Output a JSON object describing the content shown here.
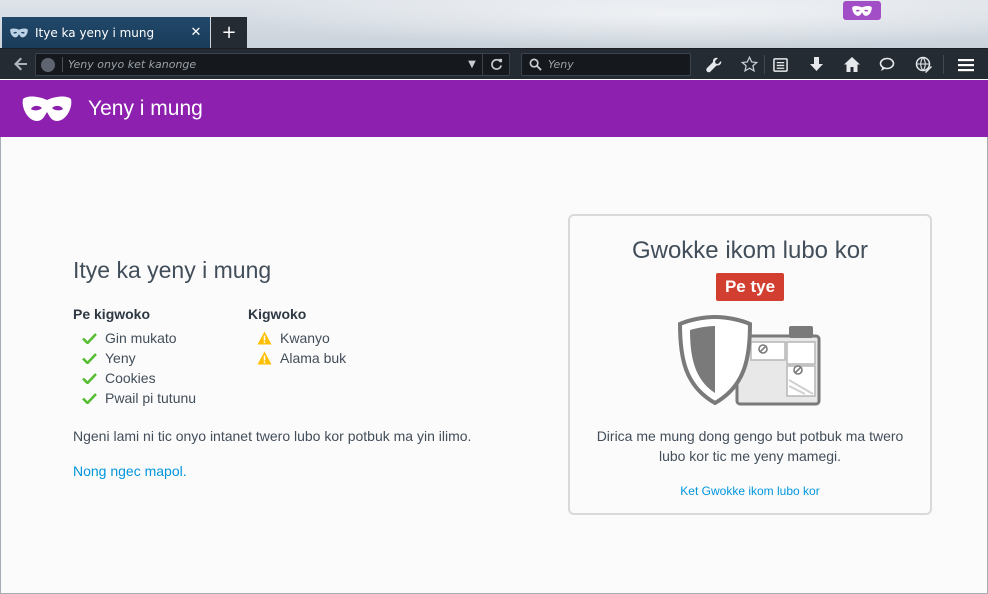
{
  "window": {
    "tab_title": "Itye ka yeny i mung",
    "tab_close": "✕",
    "new_tab": "+"
  },
  "navbar": {
    "url_placeholder": "Yeny onyo ket kanonge",
    "search_placeholder": "Yeny"
  },
  "header": {
    "title": "Yeny i mung"
  },
  "main": {
    "title": "Itye ka yeny i mung",
    "not_saved_heading": "Pe kigwoko",
    "not_saved_items": [
      "Gin mukato",
      "Yeny",
      "Cookies",
      "Pwail pi tutunu"
    ],
    "saved_heading": "Kigwoko",
    "saved_items": [
      "Kwanyo",
      "Alama buk"
    ],
    "description": "Ngeni lami ni tic onyo intanet twero lubo kor potbuk ma yin ilimo.",
    "learn_more": "Nong ngec mapol."
  },
  "tracking_card": {
    "title": "Gwokke ikom lubo kor",
    "status_badge": "Pe tye",
    "description": "Dirica me mung dong gengo but potbuk ma twero lubo kor tic me yeny mamegi.",
    "link": "Ket Gwokke ikom lubo kor"
  },
  "colors": {
    "private_purple": "#8d20ae",
    "badge_red": "#d23f30",
    "link_blue": "#0096dd",
    "check_green": "#57bd35",
    "warning_yellow": "#ffbf00",
    "chrome_dark": "#252b33"
  }
}
